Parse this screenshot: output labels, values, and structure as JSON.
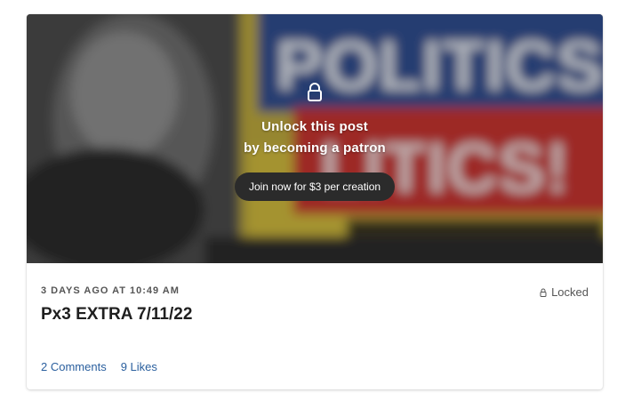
{
  "post": {
    "unlock_line1": "Unlock this post",
    "unlock_line2": "by becoming a patron",
    "join_button": "Join now for $3 per creation",
    "date": "3 DAYS AGO AT 10:49 AM",
    "title": "Px3 EXTRA 7/11/22",
    "locked_label": "Locked",
    "comments_link": "2 Comments",
    "likes_link": "9 Likes"
  },
  "icons": {
    "lock": "lock-icon",
    "small_lock": "small-lock-icon"
  },
  "colors": {
    "link": "#2a5f9e",
    "button_bg": "#2b2b2b"
  }
}
